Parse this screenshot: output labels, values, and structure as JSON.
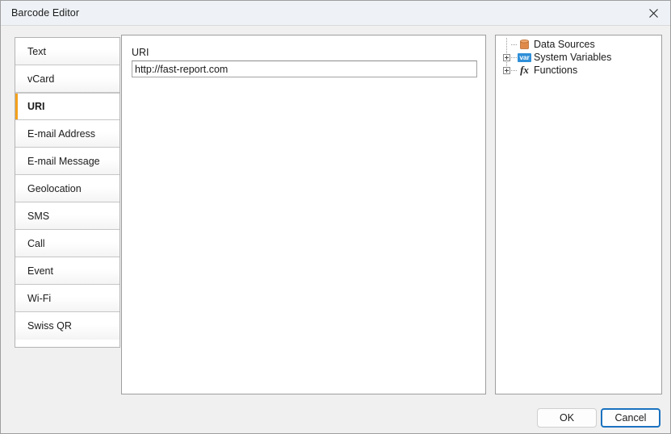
{
  "window": {
    "title": "Barcode Editor",
    "close_icon": "close-icon"
  },
  "tabs": [
    {
      "label": "Text",
      "selected": false
    },
    {
      "label": "vCard",
      "selected": false
    },
    {
      "label": "URI",
      "selected": true
    },
    {
      "label": "E-mail Address",
      "selected": false
    },
    {
      "label": "E-mail Message",
      "selected": false
    },
    {
      "label": "Geolocation",
      "selected": false
    },
    {
      "label": "SMS",
      "selected": false
    },
    {
      "label": "Call",
      "selected": false
    },
    {
      "label": "Event",
      "selected": false
    },
    {
      "label": "Wi-Fi",
      "selected": false
    },
    {
      "label": "Swiss QR",
      "selected": false
    }
  ],
  "form": {
    "uri_label": "URI",
    "uri_value": "http://fast-report.com",
    "uri_placeholder": ""
  },
  "tree": {
    "nodes": [
      {
        "label": "Data Sources",
        "icon": "database-icon",
        "expandable": false
      },
      {
        "label": "System Variables",
        "icon": "variable-icon",
        "expandable": true
      },
      {
        "label": "Functions",
        "icon": "function-icon",
        "expandable": true
      }
    ]
  },
  "footer": {
    "ok_label": "OK",
    "cancel_label": "Cancel"
  },
  "colors": {
    "accent": "#f3a01c",
    "focus": "#1a72c0",
    "database": "#e08a4a",
    "variable": "#2f8fd8",
    "titlebar": "#eef2f6",
    "dialog_bg": "#f0f0f0"
  }
}
